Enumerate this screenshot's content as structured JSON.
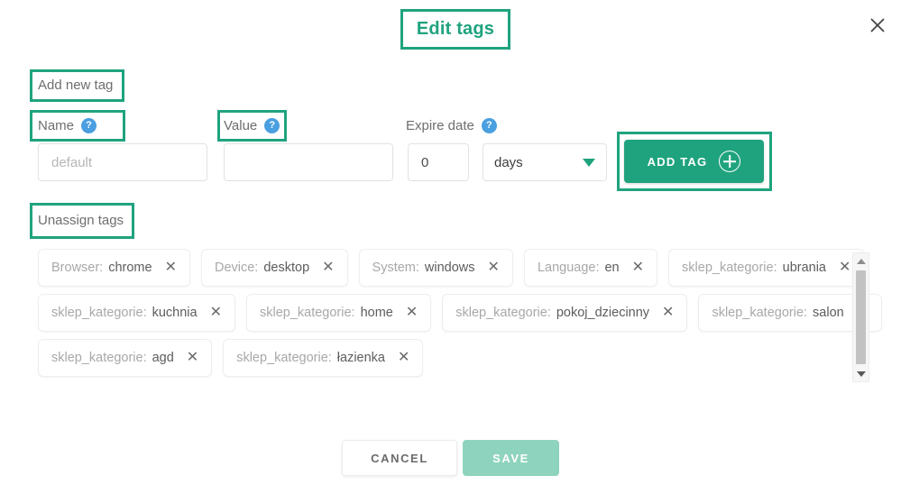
{
  "dialog": {
    "title": "Edit tags",
    "close_icon": "close-icon"
  },
  "add_new_tag": {
    "section_label": "Add new tag",
    "name": {
      "label": "Name",
      "help_icon": "?",
      "placeholder": "default",
      "value": ""
    },
    "value": {
      "label": "Value",
      "help_icon": "?",
      "placeholder": "",
      "value": ""
    },
    "expire_date": {
      "label": "Expire date",
      "help_icon": "?",
      "amount": "0",
      "unit": "days",
      "unit_options": [
        "days"
      ]
    },
    "add_button": {
      "label": "ADD TAG",
      "icon": "plus-circle-icon"
    }
  },
  "unassign_tags": {
    "section_label": "Unassign tags",
    "remove_icon": "✕",
    "rows": [
      [
        {
          "key": "Browser:",
          "value": "chrome"
        },
        {
          "key": "Device:",
          "value": "desktop"
        },
        {
          "key": "System:",
          "value": "windows"
        },
        {
          "key": "Language:",
          "value": "en"
        },
        {
          "key": "sklep_kategorie:",
          "value": "ubrania"
        }
      ],
      [
        {
          "key": "sklep_kategorie:",
          "value": "kuchnia"
        },
        {
          "key": "sklep_kategorie:",
          "value": "home"
        },
        {
          "key": "sklep_kategorie:",
          "value": "pokoj_dziecinny"
        },
        {
          "key": "sklep_kategorie:",
          "value": "salon"
        }
      ],
      [
        {
          "key": "sklep_kategorie:",
          "value": "agd"
        },
        {
          "key": "sklep_kategorie:",
          "value": "łazienka"
        }
      ]
    ]
  },
  "scrollbar": {
    "up_icon": "chevron-up-icon",
    "down_icon": "chevron-down-icon"
  },
  "footer": {
    "cancel_label": "CANCEL",
    "save_label": "SAVE"
  },
  "colors": {
    "accent": "#1fa37e",
    "save_disabled": "#8ed3bd",
    "help_blue": "#4a9fe0",
    "highlight": "#1fa37e"
  }
}
